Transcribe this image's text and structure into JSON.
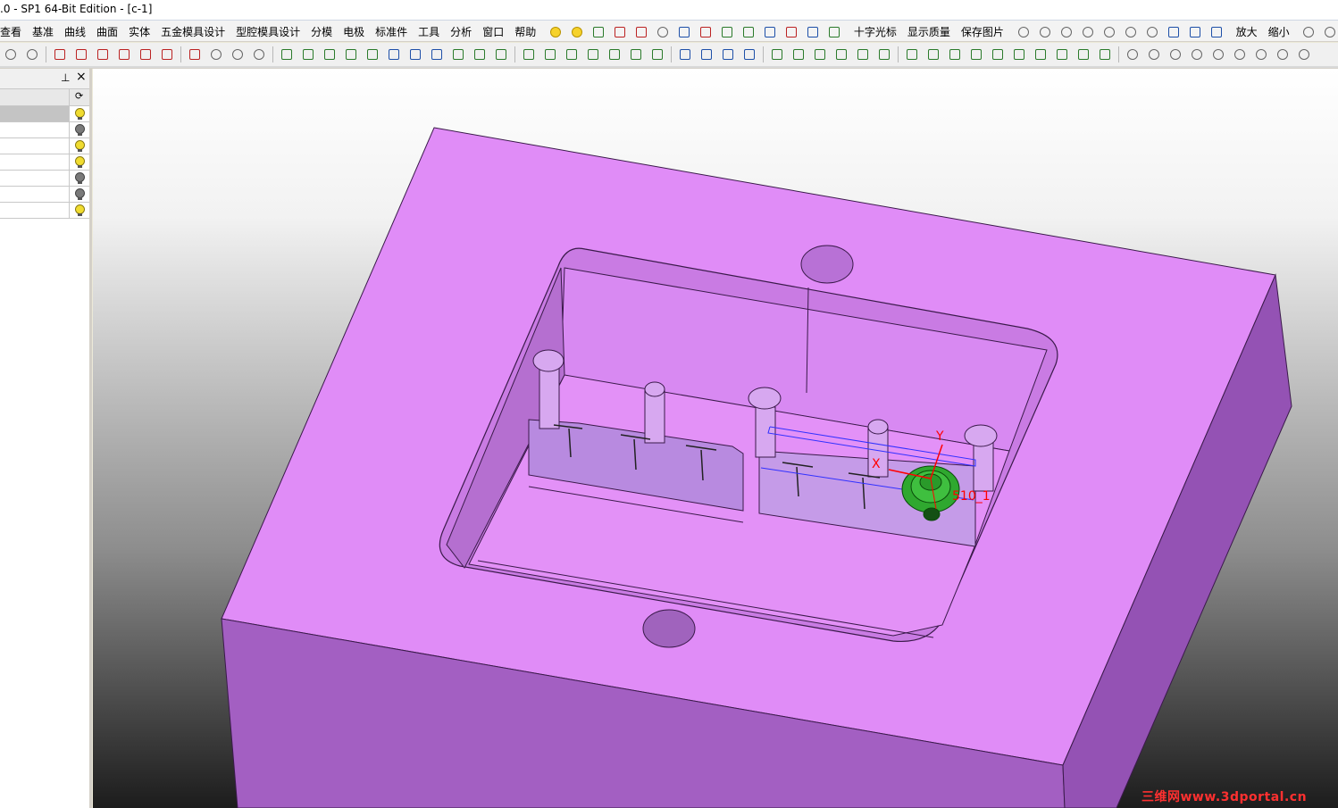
{
  "window": {
    "title": ".0 - SP1 64-Bit Edition - [c-1]"
  },
  "menu": [
    "查看",
    "基准",
    "曲线",
    "曲面",
    "实体",
    "五金模具设计",
    "型腔模具设计",
    "分模",
    "电极",
    "标准件",
    "工具",
    "分析",
    "窗口",
    "帮助"
  ],
  "toolbar_labels": {
    "crosshair": "十字光标",
    "display_quality": "显示质量",
    "save_image": "保存图片",
    "zoom_in": "放大",
    "zoom_out": "缩小"
  },
  "viewport": {
    "axis_x": "X",
    "axis_y": "Y",
    "component_label": "510_1",
    "colors": {
      "mold": "#e08cf7",
      "mold_side": "#a35fc2",
      "component": "#2fa82f",
      "axis": "#ff0000"
    }
  },
  "watermark": "三维网www.3dportal.cn",
  "panel": {
    "rows": [
      {
        "bulb": "on",
        "selected": true
      },
      {
        "bulb": "off"
      },
      {
        "bulb": "on"
      },
      {
        "bulb": "on"
      },
      {
        "bulb": "off"
      },
      {
        "bulb": "off"
      },
      {
        "bulb": "on"
      }
    ]
  }
}
